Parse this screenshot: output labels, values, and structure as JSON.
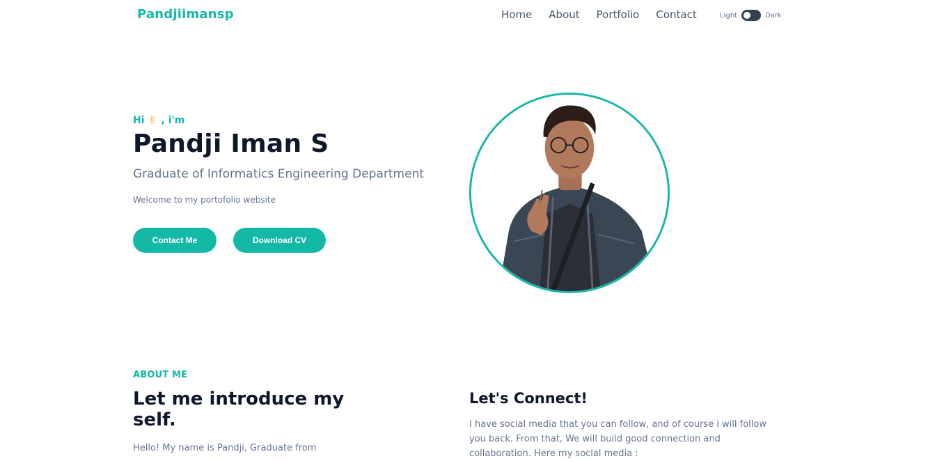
{
  "navbar": {
    "brand": "Pandjiimansp",
    "links": [
      "Home",
      "About",
      "Portfolio",
      "Contact"
    ],
    "theme_light": "Light",
    "theme_dark": "Dark"
  },
  "hero": {
    "greeting_prefix": "Hi",
    "greeting_suffix": ", i'm",
    "name": "Pandji Iman S",
    "subtitle": "Graduate of Informatics Engineering Department",
    "welcome": "Welcome to my portofolio website",
    "contact_button": "Contact Me",
    "cv_button": "Download CV"
  },
  "about": {
    "tag": "ABOUT ME",
    "title": "Let me introduce my self.",
    "text": "Hello! My name is Pandji, Graduate from"
  },
  "connect": {
    "title": "Let's Connect!",
    "text": "I have social media that you can follow, and of course i will follow you back. From that, We will build good connection and collaboration. Here my social media :"
  },
  "colors": {
    "accent": "#14b8a6",
    "heading": "#0f172a",
    "muted": "#64748b",
    "toggle": "#334155"
  }
}
